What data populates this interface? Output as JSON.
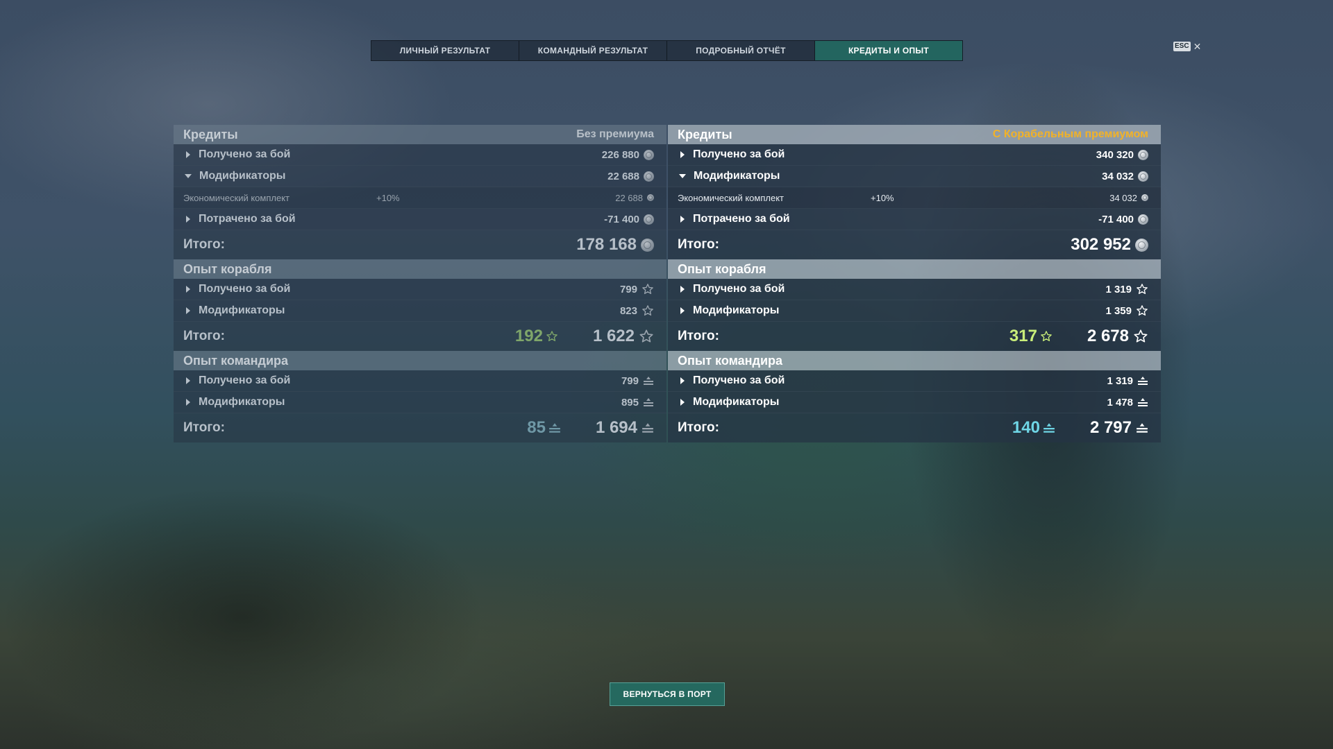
{
  "tabs": [
    {
      "label": "ЛИЧНЫЙ РЕЗУЛЬТАТ"
    },
    {
      "label": "КОМАНДНЫЙ РЕЗУЛЬТАТ"
    },
    {
      "label": "ПОДРОБНЫЙ ОТЧЁТ"
    },
    {
      "label": "КРЕДИТЫ И ОПЫТ",
      "active": true
    }
  ],
  "esc": {
    "key": "ESC",
    "close": "✕"
  },
  "left": {
    "credits": {
      "title": "Кредиты",
      "note": "Без премиума",
      "earned": {
        "label": "Получено за бой",
        "value": "226 880"
      },
      "modifiers": {
        "label": "Модификаторы",
        "value": "22 688"
      },
      "econ": {
        "label": "Экономический комплект",
        "pct": "+10%",
        "value": "22 688"
      },
      "spent": {
        "label": "Потрачено за бой",
        "value": "-71 400"
      },
      "total": {
        "label": "Итого:",
        "value": "178 168"
      }
    },
    "ship_xp": {
      "title": "Опыт корабля",
      "earned": {
        "label": "Получено за бой",
        "value": "799"
      },
      "modifiers": {
        "label": "Модификаторы",
        "value": "823"
      },
      "total": {
        "label": "Итого:",
        "bonus": "192",
        "value": "1 622"
      }
    },
    "commander_xp": {
      "title": "Опыт командира",
      "earned": {
        "label": "Получено за бой",
        "value": "799"
      },
      "modifiers": {
        "label": "Модификаторы",
        "value": "895"
      },
      "total": {
        "label": "Итого:",
        "bonus": "85",
        "value": "1 694"
      }
    }
  },
  "right": {
    "credits": {
      "title": "Кредиты",
      "note": "С Корабельным премиумом",
      "earned": {
        "label": "Получено за бой",
        "value": "340 320"
      },
      "modifiers": {
        "label": "Модификаторы",
        "value": "34 032"
      },
      "econ": {
        "label": "Экономический комплект",
        "pct": "+10%",
        "value": "34 032"
      },
      "spent": {
        "label": "Потрачено за бой",
        "value": "-71 400"
      },
      "total": {
        "label": "Итого:",
        "value": "302 952"
      }
    },
    "ship_xp": {
      "title": "Опыт корабля",
      "earned": {
        "label": "Получено за бой",
        "value": "1 319"
      },
      "modifiers": {
        "label": "Модификаторы",
        "value": "1 359"
      },
      "total": {
        "label": "Итого:",
        "bonus": "317",
        "value": "2 678"
      }
    },
    "commander_xp": {
      "title": "Опыт командира",
      "earned": {
        "label": "Получено за бой",
        "value": "1 319"
      },
      "modifiers": {
        "label": "Модификаторы",
        "value": "1 478"
      },
      "total": {
        "label": "Итого:",
        "bonus": "140",
        "value": "2 797"
      }
    }
  },
  "colors": {
    "accent": "#236e64",
    "premium_note": "#f2b227",
    "ship_xp_bonus": "#c9ee7a",
    "commander_xp_bonus": "#6fd6e6"
  },
  "icons": {
    "credits": "credit-coin-icon",
    "ship_xp": "star-icon",
    "commander_xp": "commander-xp-icon"
  },
  "back_button": {
    "label": "ВЕРНУТЬСЯ В ПОРТ"
  }
}
